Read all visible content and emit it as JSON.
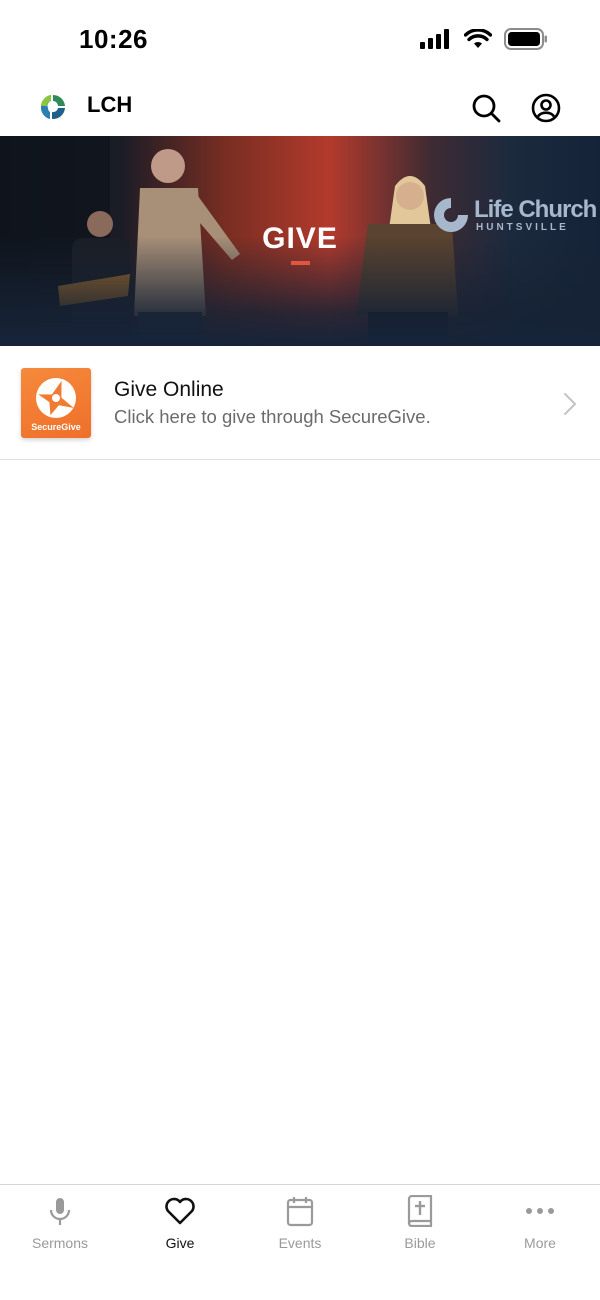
{
  "status_bar": {
    "time": "10:26"
  },
  "header": {
    "title": "LCH",
    "icons": [
      "logo-icon",
      "search-icon",
      "account-icon"
    ]
  },
  "hero": {
    "title": "GIVE",
    "brand_name": "Life Church",
    "brand_sub": "HUNTSVILLE",
    "accent_color": "#e0573d"
  },
  "give_item": {
    "thumb_label": "SecureGive",
    "title": "Give Online",
    "subtitle": "Click here to give through SecureGive.",
    "brand_color": "#f07b31"
  },
  "tabs": [
    {
      "label": "Sermons",
      "icon": "microphone-icon",
      "active": false
    },
    {
      "label": "Give",
      "icon": "heart-icon",
      "active": true
    },
    {
      "label": "Events",
      "icon": "calendar-icon",
      "active": false
    },
    {
      "label": "Bible",
      "icon": "bible-icon",
      "active": false
    },
    {
      "label": "More",
      "icon": "more-dots-icon",
      "active": false
    }
  ]
}
